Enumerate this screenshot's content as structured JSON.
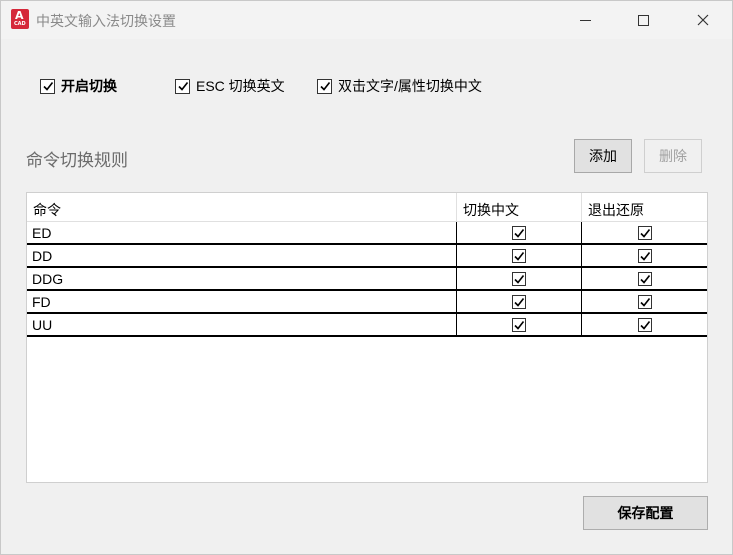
{
  "window": {
    "title": "中英文输入法切换设置",
    "icon_letter": "A",
    "icon_sublabel": "CAD",
    "icon_color": "#d5283a"
  },
  "options": [
    {
      "label": "开启切换",
      "checked": true
    },
    {
      "label": "ESC 切换英文",
      "checked": true
    },
    {
      "label": "双击文字/属性切换中文",
      "checked": true
    }
  ],
  "rules": {
    "title": "命令切换规则",
    "add_label": "添加",
    "delete_label": "删除",
    "columns": [
      "命令",
      "切换中文",
      "退出还原"
    ],
    "rows": [
      {
        "command": "ED",
        "switch_cn": true,
        "restore": true
      },
      {
        "command": "DD",
        "switch_cn": true,
        "restore": true
      },
      {
        "command": "DDG",
        "switch_cn": true,
        "restore": true
      },
      {
        "command": "FD",
        "switch_cn": true,
        "restore": true
      },
      {
        "command": "UU",
        "switch_cn": true,
        "restore": true
      }
    ]
  },
  "save_label": "保存配置"
}
